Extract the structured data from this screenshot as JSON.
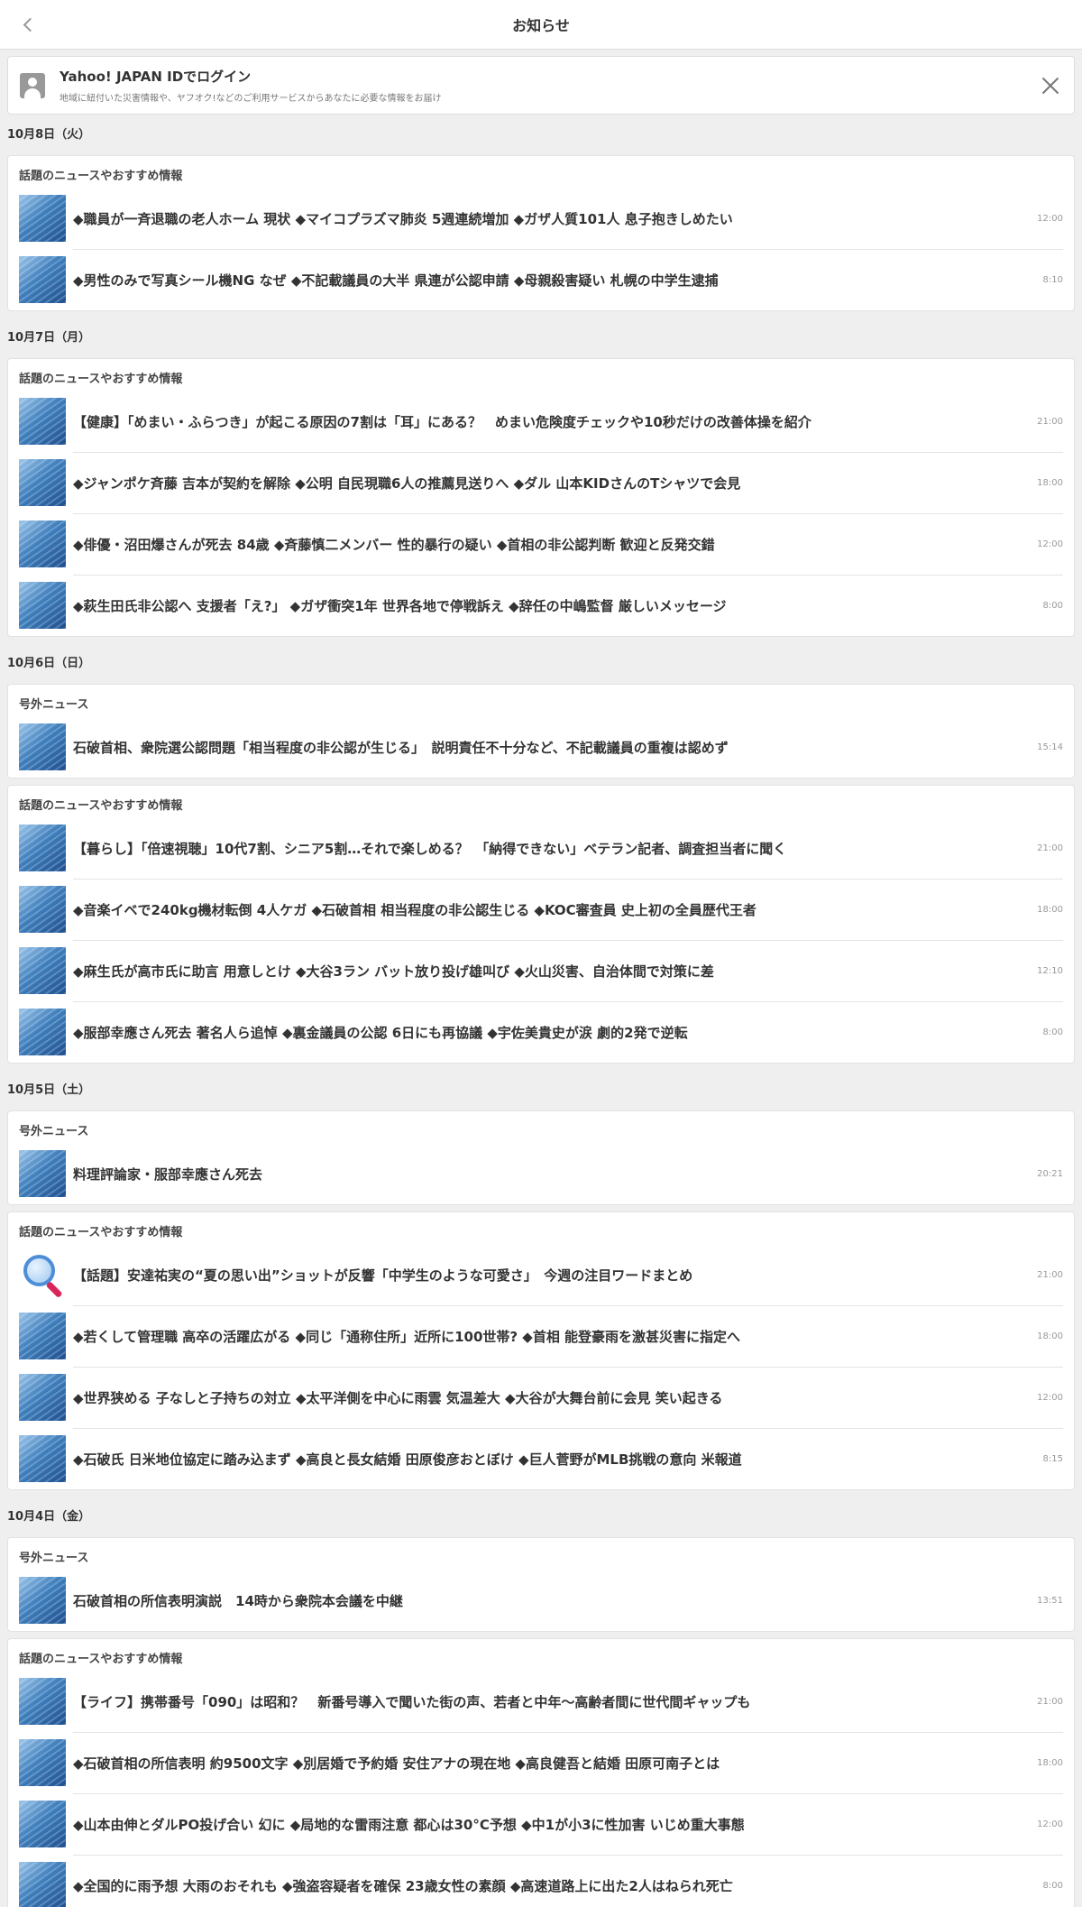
{
  "header": {
    "title": "お知らせ"
  },
  "login": {
    "title": "Yahoo! JAPAN IDでログイン",
    "subtitle": "地域に紐付いた災害情報や、ヤフオク!などのご利用サービスからあなたに必要な情報をお届け"
  },
  "days": [
    {
      "date": "10月8日（火）",
      "cards": [
        {
          "label": "話題のニュースやおすすめ情報",
          "items": [
            {
              "text": "◆職員が一斉退職の老人ホーム 現状 ◆マイコプラズマ肺炎 5週連続増加 ◆ガザ人質101人 息子抱きしめたい",
              "time": "12:00",
              "icon": "news-thumbnail"
            },
            {
              "text": "◆男性のみで写真シール機NG なぜ ◆不記載議員の大半 県連が公認申請 ◆母親殺害疑い 札幌の中学生逮捕",
              "time": "8:10",
              "icon": "news-thumbnail"
            }
          ]
        }
      ]
    },
    {
      "date": "10月7日（月）",
      "cards": [
        {
          "label": "話題のニュースやおすすめ情報",
          "items": [
            {
              "text": "【健康】「めまい・ふらつき」が起こる原因の7割は「耳」にある？　めまい危険度チェックや10秒だけの改善体操を紹介",
              "time": "21:00",
              "icon": "news-thumbnail"
            },
            {
              "text": "◆ジャンポケ斉藤 吉本が契約を解除 ◆公明 自民現職6人の推薦見送りへ ◆ダル 山本KIDさんのTシャツで会見",
              "time": "18:00",
              "icon": "news-thumbnail"
            },
            {
              "text": "◆俳優・沼田爆さんが死去 84歳 ◆斉藤慎二メンバー 性的暴行の疑い ◆首相の非公認判断 歓迎と反発交錯",
              "time": "12:00",
              "icon": "news-thumbnail"
            },
            {
              "text": "◆萩生田氏非公認へ 支援者「え?」 ◆ガザ衝突1年 世界各地で停戦訴え ◆辞任の中嶋監督 厳しいメッセージ",
              "time": "8:00",
              "icon": "news-thumbnail"
            }
          ]
        }
      ]
    },
    {
      "date": "10月6日（日）",
      "cards": [
        {
          "label": "号外ニュース",
          "items": [
            {
              "text": "石破首相、衆院選公認問題「相当程度の非公認が生じる」　説明責任不十分など、不記載議員の重複は認めず",
              "time": "15:14",
              "icon": "news-thumbnail"
            }
          ]
        },
        {
          "label": "話題のニュースやおすすめ情報",
          "items": [
            {
              "text": "【暮らし】「倍速視聴」10代7割、シニア5割…それで楽しめる？　「納得できない」ベテラン記者、調査担当者に聞く",
              "time": "21:00",
              "icon": "news-thumbnail"
            },
            {
              "text": "◆音楽イベで240kg機材転倒 4人ケガ ◆石破首相 相当程度の非公認生じる ◆KOC審査員 史上初の全員歴代王者",
              "time": "18:00",
              "icon": "news-thumbnail"
            },
            {
              "text": "◆麻生氏が高市氏に助言 用意しとけ ◆大谷3ラン バット放り投げ雄叫び ◆火山災害、自治体間で対策に差",
              "time": "12:10",
              "icon": "news-thumbnail"
            },
            {
              "text": "◆服部幸應さん死去 著名人ら追悼 ◆裏金議員の公認 6日にも再協議 ◆宇佐美貴史が涙 劇的2発で逆転",
              "time": "8:00",
              "icon": "news-thumbnail"
            }
          ]
        }
      ]
    },
    {
      "date": "10月5日（土）",
      "cards": [
        {
          "label": "号外ニュース",
          "items": [
            {
              "text": "料理評論家・服部幸應さん死去",
              "time": "20:21",
              "icon": "news-thumbnail"
            }
          ]
        },
        {
          "label": "話題のニュースやおすすめ情報",
          "items": [
            {
              "text": "【話題】安達祐実の“夏の思い出”ショットが反響「中学生のような可愛さ」　今週の注目ワードまとめ",
              "time": "21:00",
              "icon": "magnifier-icon"
            },
            {
              "text": "◆若くして管理職 高卒の活躍広がる ◆同じ「通称住所」近所に100世帯? ◆首相 能登豪雨を激甚災害に指定へ",
              "time": "18:00",
              "icon": "news-thumbnail"
            },
            {
              "text": "◆世界狭める 子なしと子持ちの対立 ◆太平洋側を中心に雨雲 気温差大 ◆大谷が大舞台前に会見 笑い起きる",
              "time": "12:00",
              "icon": "news-thumbnail"
            },
            {
              "text": "◆石破氏 日米地位協定に踏み込まず ◆高良と長女結婚 田原俊彦おとぼけ ◆巨人菅野がMLB挑戦の意向 米報道",
              "time": "8:15",
              "icon": "news-thumbnail"
            }
          ]
        }
      ]
    },
    {
      "date": "10月4日（金）",
      "cards": [
        {
          "label": "号外ニュース",
          "items": [
            {
              "text": "石破首相の所信表明演説　14時から衆院本会議を中継",
              "time": "13:51",
              "icon": "news-thumbnail"
            }
          ]
        },
        {
          "label": "話題のニュースやおすすめ情報",
          "items": [
            {
              "text": "【ライフ】携帯番号「090」は昭和？　新番号導入で聞いた街の声、若者と中年〜高齢者間に世代間ギャップも",
              "time": "21:00",
              "icon": "news-thumbnail"
            },
            {
              "text": "◆石破首相の所信表明 約9500文字 ◆別居婚で予約婚 安住アナの現在地 ◆高良健吾と結婚 田原可南子とは",
              "time": "18:00",
              "icon": "news-thumbnail"
            },
            {
              "text": "◆山本由伸とダルPO投げ合い 幻に ◆局地的な雷雨注意 都心は30°C予想 ◆中1が小3に性加害 いじめ重大事態",
              "time": "12:00",
              "icon": "news-thumbnail"
            },
            {
              "text": "◆全国的に雨予想 大雨のおそれも ◆強盗容疑者を確保 23歳女性の素顔 ◆高速道路上に出た2人はねられ死亡",
              "time": "8:00",
              "icon": "news-thumbnail"
            }
          ]
        }
      ]
    }
  ]
}
